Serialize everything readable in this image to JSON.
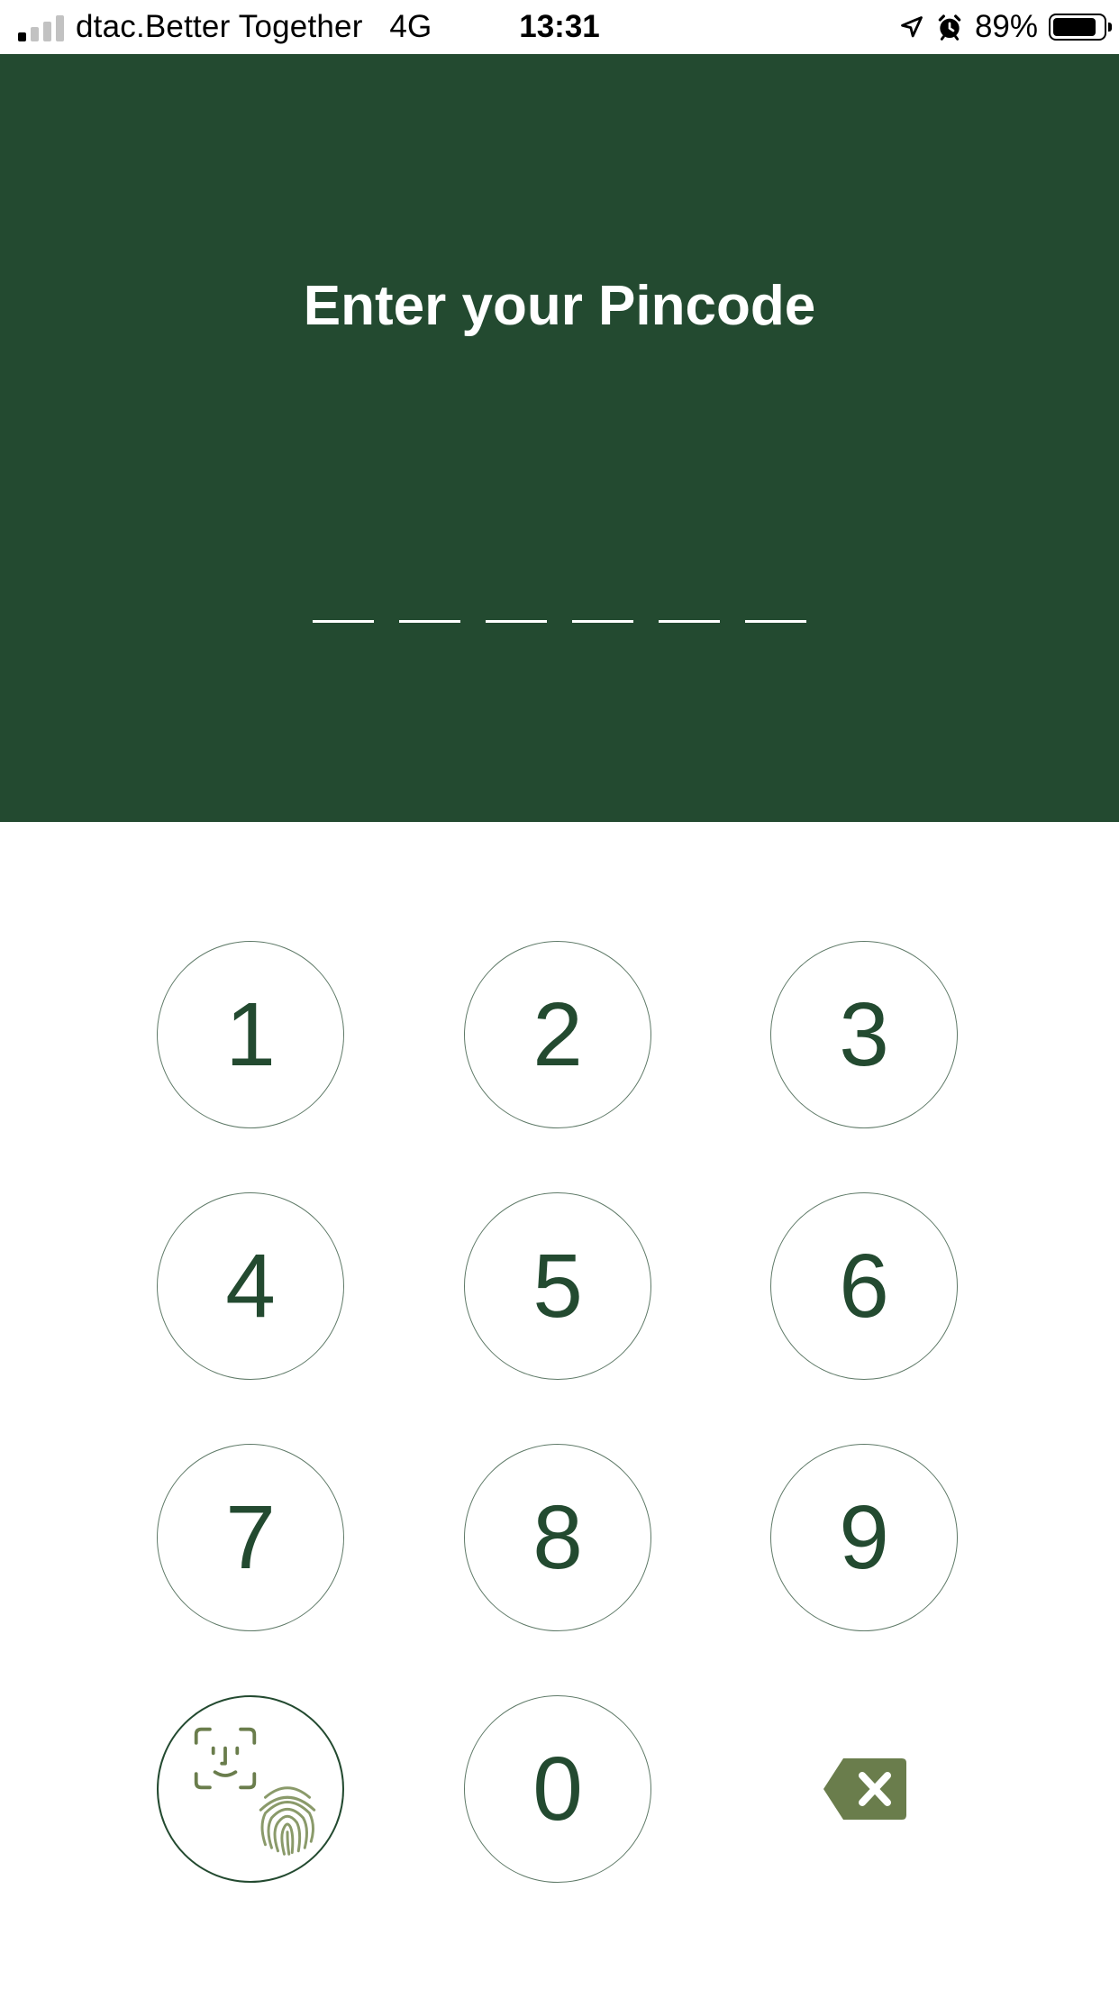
{
  "status_bar": {
    "carrier": "dtac.Better Together",
    "network": "4G",
    "time": "13:31",
    "battery_percent": "89%",
    "battery_level": 0.89,
    "signal_bars_active": 1,
    "signal_bars_total": 4,
    "icons": [
      "location-arrow-icon",
      "alarm-clock-icon",
      "battery-icon"
    ]
  },
  "header": {
    "title": "Enter your Pincode",
    "pin_length": 6,
    "pin_entered": 0,
    "background_color": "#234a30"
  },
  "keypad": {
    "keys": [
      "1",
      "2",
      "3",
      "4",
      "5",
      "6",
      "7",
      "8",
      "9",
      "0"
    ],
    "biometric_icons": [
      "face-id-icon",
      "fingerprint-icon"
    ],
    "delete_icon": "backspace-icon",
    "digit_color": "#234a30",
    "accent_color": "#6a7d4c"
  }
}
